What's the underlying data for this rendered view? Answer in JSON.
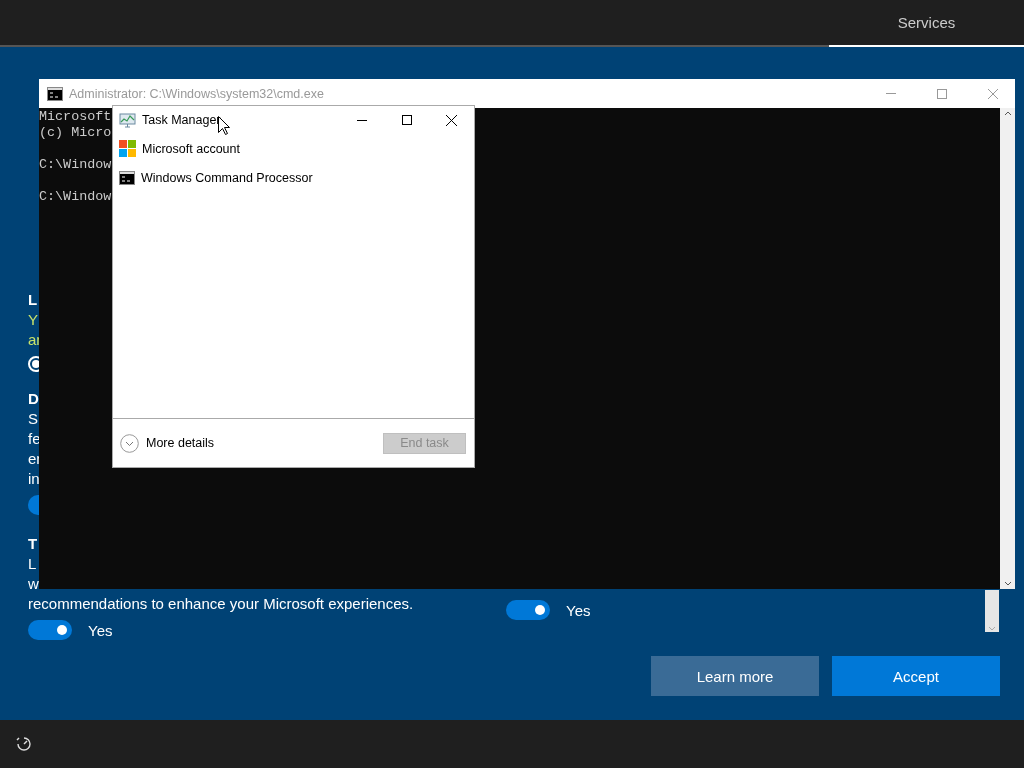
{
  "header": {
    "sections": [
      {
        "label": "Services",
        "selected": true
      }
    ]
  },
  "settings_left": [
    {
      "kind": "heading",
      "text": "L"
    },
    {
      "kind": "notice",
      "text": "Y"
    },
    {
      "kind": "notice",
      "text": "ar"
    },
    {
      "kind": "radio",
      "selected": true
    },
    {
      "kind": "heading",
      "text": "D"
    },
    {
      "kind": "body",
      "text": "S"
    },
    {
      "kind": "body",
      "text": "fe"
    },
    {
      "kind": "body",
      "text": "er"
    },
    {
      "kind": "body",
      "text": "in"
    },
    {
      "kind": "toggle",
      "on": true
    },
    {
      "kind": "heading",
      "text": "T"
    },
    {
      "kind": "body",
      "text": "L"
    },
    {
      "kind": "body",
      "text": "w"
    },
    {
      "kind": "body",
      "text": "recommendations to enhance your Microsoft experiences."
    },
    {
      "kind": "toggle",
      "on": true,
      "label": "Yes"
    }
  ],
  "settings_right": [
    {
      "kind": "toggle",
      "on": true,
      "label": "Yes"
    }
  ],
  "buttons": [
    {
      "label": "Learn more",
      "kind": "secondary"
    },
    {
      "label": "Accept",
      "kind": "primary"
    }
  ],
  "cmd_window": {
    "title": "Administrator: C:\\Windows\\system32\\cmd.exe",
    "lines": [
      "Microsoft",
      "(c) Micro",
      "C:\\Window",
      "C:\\Window"
    ]
  },
  "task_manager": {
    "title": "Task Manager",
    "apps": [
      {
        "name": "Microsoft account"
      },
      {
        "name": "Windows Command Processor"
      }
    ],
    "more_details": "More details",
    "end_task": {
      "label": "End task",
      "disabled": true
    }
  }
}
